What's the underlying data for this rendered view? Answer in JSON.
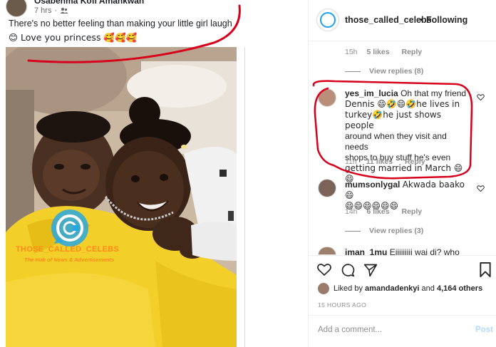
{
  "facebook_post": {
    "author_name": "Osabenma Kofi Amankwah",
    "time": "7 hrs",
    "privacy_icon": "friends-icon",
    "text_line1": "There's no better feeling than making your little girl laugh",
    "text_line2": "😊 Love you princess 🥰🥰🥰",
    "watermark_title": "THOSE_CALLED_CELEBS",
    "watermark_subtitle": "The Hub of News & Advertisements"
  },
  "instagram": {
    "account": "those_called_celebs",
    "separator": "•",
    "follow_status": "Following",
    "comments": [
      {
        "time": "15h",
        "likes": "5 likes",
        "reply": "Reply",
        "view_replies": "View replies (8)"
      },
      {
        "username": "yes_im_lucia",
        "text": "Oh that my friend Dennis 😄😄😄🤣he lives in turkey🤣he just shows people around when they visit and needs shops to buy stuff he's even getting married in March 😄😄",
        "line1": "Oh that my friend",
        "line2": "Dennis 😄🤣😄🤣he lives in",
        "line3": "turkey🤣he just shows people",
        "line4": "around when they visit and needs",
        "line5": "shops to buy stuff he's even",
        "line6": "getting married in March 😄😄",
        "time": "11h",
        "likes": "11 likes",
        "reply": "Reply"
      },
      {
        "username": "mumsonlygal",
        "line1": "Akwada baako 😄",
        "line2": "😄😄😄😄😄😄",
        "time": "14h",
        "likes": "6 likes",
        "reply": "Reply",
        "view_replies": "View replies (3)"
      },
      {
        "username": "iman_1mu",
        "text": "Eiiiiiiiii wai di? who"
      }
    ],
    "liked_by_prefix": "Liked by",
    "liked_by_user": "amandadenkyi",
    "liked_by_and": "and",
    "liked_by_others": "4,164 others",
    "posted_ago": "15 HOURS AGO",
    "add_comment_placeholder": "Add a comment...",
    "post_label": "Post"
  },
  "colors": {
    "annotation_red": "#d6001c",
    "watermark_orange": "#ff8a1a",
    "watermark_blue": "#29a8e0",
    "ig_link_disabled": "#b3dbff"
  }
}
